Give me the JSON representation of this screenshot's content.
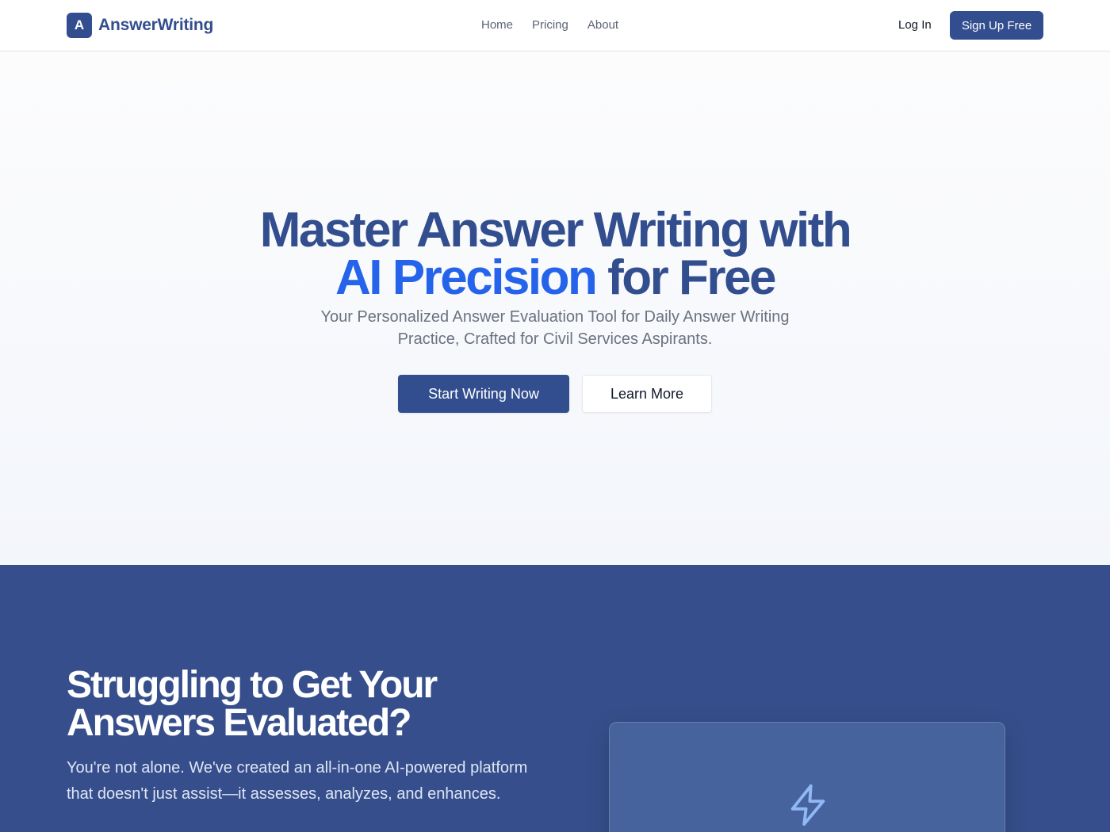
{
  "header": {
    "logo_letter": "A",
    "brand_name": "AnswerWriting",
    "nav": [
      "Home",
      "Pricing",
      "About"
    ],
    "login_label": "Log In",
    "signup_label": "Sign Up Free"
  },
  "hero": {
    "title_line1": "Master Answer Writing with",
    "title_accent": "AI Precision",
    "title_line2_rest": "for Free",
    "subtitle": "Your Personalized Answer Evaluation Tool for Daily Answer Writing Practice, Crafted for Civil Services Aspirants.",
    "primary_cta": "Start Writing Now",
    "secondary_cta": "Learn More"
  },
  "problem": {
    "title": "Struggling to Get Your Answers Evaluated?",
    "text": "You're not alone. We've created an all-in-one AI-powered platform that doesn't just assist—it assesses, analyzes, and enhances.",
    "card_icon": "lightning-bolt-icon"
  },
  "colors": {
    "brand": "#334e8e",
    "accent": "#2563eb",
    "section_bg": "#364f8c",
    "card_bg": "#46639e",
    "icon": "#8fb8f5"
  }
}
